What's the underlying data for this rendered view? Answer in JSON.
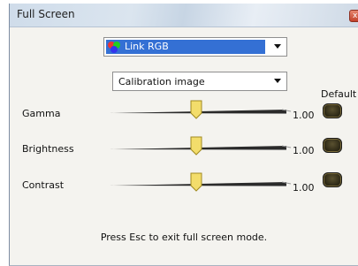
{
  "window": {
    "title": "Full Screen",
    "close_glyph": "x"
  },
  "profile_dropdown": {
    "selected": "Link RGB",
    "icon": "rgb-circles-icon"
  },
  "image_dropdown": {
    "selected": "Calibration image"
  },
  "default_header": "Default",
  "controls": [
    {
      "label": "Gamma",
      "value": "1.00",
      "level": 0.5
    },
    {
      "label": "Brightness",
      "value": "1.00",
      "level": 0.5
    },
    {
      "label": "Contrast",
      "value": "1.00",
      "level": 0.5
    }
  ],
  "footer": "Press Esc to exit full screen mode.",
  "colors": {
    "accent": "#3470d4",
    "thumb": "#f3dd6b"
  }
}
